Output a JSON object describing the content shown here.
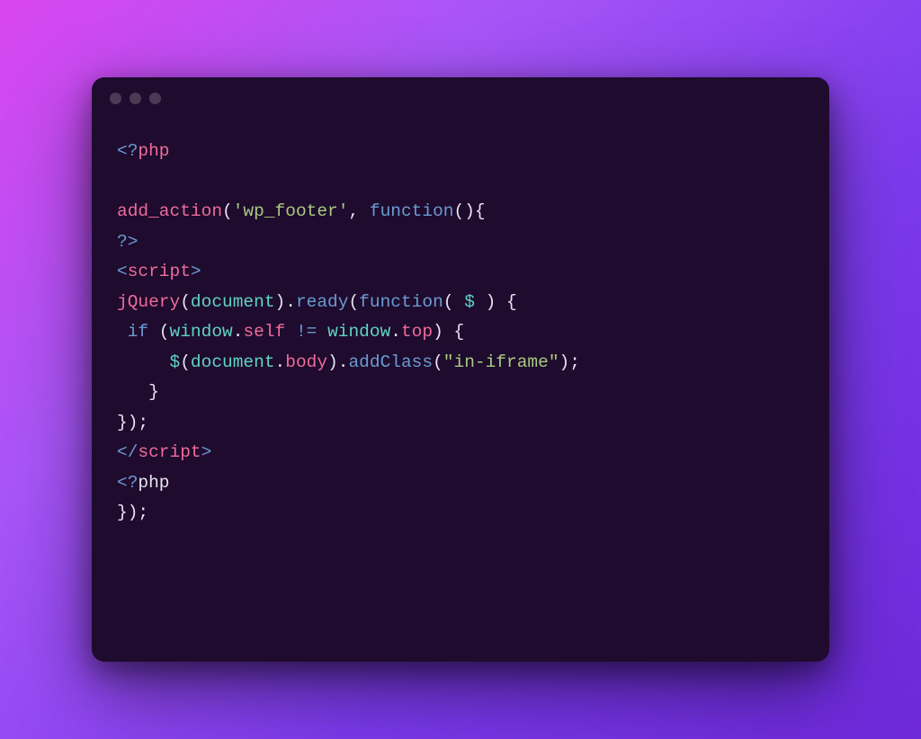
{
  "titlebar": {
    "dots": [
      "dim",
      "dim",
      "dim"
    ]
  },
  "code": {
    "tokens": [
      [
        {
          "cls": "tag-bracket",
          "t": "<?"
        },
        {
          "cls": "tag-name",
          "t": "php"
        }
      ],
      [],
      [
        {
          "cls": "func-red",
          "t": "add_action"
        },
        {
          "cls": "punct",
          "t": "("
        },
        {
          "cls": "string",
          "t": "'wp_footer'"
        },
        {
          "cls": "punct",
          "t": ", "
        },
        {
          "cls": "keyword",
          "t": "function"
        },
        {
          "cls": "punct",
          "t": "(){"
        }
      ],
      [
        {
          "cls": "tag-bracket",
          "t": "?>"
        }
      ],
      [
        {
          "cls": "tag-bracket",
          "t": "<"
        },
        {
          "cls": "func-red",
          "t": "script"
        },
        {
          "cls": "tag-bracket",
          "t": ">"
        }
      ],
      [
        {
          "cls": "func-red",
          "t": "jQuery"
        },
        {
          "cls": "punct",
          "t": "("
        },
        {
          "cls": "prop-teal",
          "t": "document"
        },
        {
          "cls": "punct",
          "t": ")."
        },
        {
          "cls": "keyword",
          "t": "ready"
        },
        {
          "cls": "punct",
          "t": "("
        },
        {
          "cls": "keyword",
          "t": "function"
        },
        {
          "cls": "punct",
          "t": "( "
        },
        {
          "cls": "prop-teal",
          "t": "$"
        },
        {
          "cls": "punct",
          "t": " ) {"
        }
      ],
      [
        {
          "cls": "plain",
          "t": " "
        },
        {
          "cls": "keyword",
          "t": "if"
        },
        {
          "cls": "punct",
          "t": " ("
        },
        {
          "cls": "prop-teal",
          "t": "window"
        },
        {
          "cls": "punct",
          "t": "."
        },
        {
          "cls": "prop-pink",
          "t": "self"
        },
        {
          "cls": "punct",
          "t": " "
        },
        {
          "cls": "operator",
          "t": "!="
        },
        {
          "cls": "punct",
          "t": " "
        },
        {
          "cls": "prop-teal",
          "t": "window"
        },
        {
          "cls": "punct",
          "t": "."
        },
        {
          "cls": "prop-pink",
          "t": "top"
        },
        {
          "cls": "punct",
          "t": ") {"
        }
      ],
      [
        {
          "cls": "plain",
          "t": "     "
        },
        {
          "cls": "prop-teal",
          "t": "$"
        },
        {
          "cls": "punct",
          "t": "("
        },
        {
          "cls": "prop-teal",
          "t": "document"
        },
        {
          "cls": "punct",
          "t": "."
        },
        {
          "cls": "prop-pink",
          "t": "body"
        },
        {
          "cls": "punct",
          "t": ")."
        },
        {
          "cls": "keyword",
          "t": "addClass"
        },
        {
          "cls": "punct",
          "t": "("
        },
        {
          "cls": "string",
          "t": "\"in-iframe\""
        },
        {
          "cls": "punct",
          "t": ");"
        }
      ],
      [
        {
          "cls": "punct",
          "t": "   }"
        }
      ],
      [
        {
          "cls": "punct",
          "t": "});"
        }
      ],
      [
        {
          "cls": "tag-bracket",
          "t": "</"
        },
        {
          "cls": "func-red",
          "t": "script"
        },
        {
          "cls": "tag-bracket",
          "t": ">"
        }
      ],
      [
        {
          "cls": "tag-bracket",
          "t": "<?"
        },
        {
          "cls": "plain",
          "t": "php"
        }
      ],
      [
        {
          "cls": "punct",
          "t": "});"
        }
      ]
    ]
  }
}
